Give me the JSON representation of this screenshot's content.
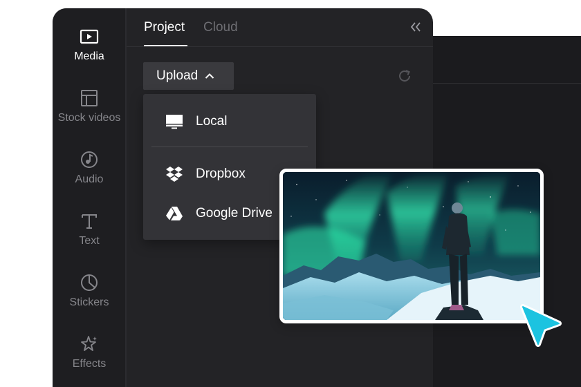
{
  "sidebar": {
    "items": [
      {
        "label": "Media",
        "icon": "media-play-icon",
        "active": true
      },
      {
        "label": "Stock videos",
        "icon": "layout-icon",
        "active": false
      },
      {
        "label": "Audio",
        "icon": "music-note-icon",
        "active": false
      },
      {
        "label": "Text",
        "icon": "text-t-icon",
        "active": false
      },
      {
        "label": "Stickers",
        "icon": "sticker-icon",
        "active": false
      },
      {
        "label": "Effects",
        "icon": "sparkle-star-icon",
        "active": false
      }
    ]
  },
  "tabs": [
    {
      "label": "Project",
      "active": true
    },
    {
      "label": "Cloud",
      "active": false
    }
  ],
  "upload": {
    "label": "Upload",
    "menu": [
      {
        "label": "Local",
        "icon": "monitor-icon"
      },
      {
        "label": "Dropbox",
        "icon": "dropbox-icon"
      },
      {
        "label": "Google Drive",
        "icon": "google-drive-icon"
      }
    ]
  },
  "colors": {
    "accent_cursor": "#1cc3e0",
    "panel_bg": "#232326",
    "sidebar_bg": "#1e1e21",
    "menu_bg": "#333337"
  }
}
